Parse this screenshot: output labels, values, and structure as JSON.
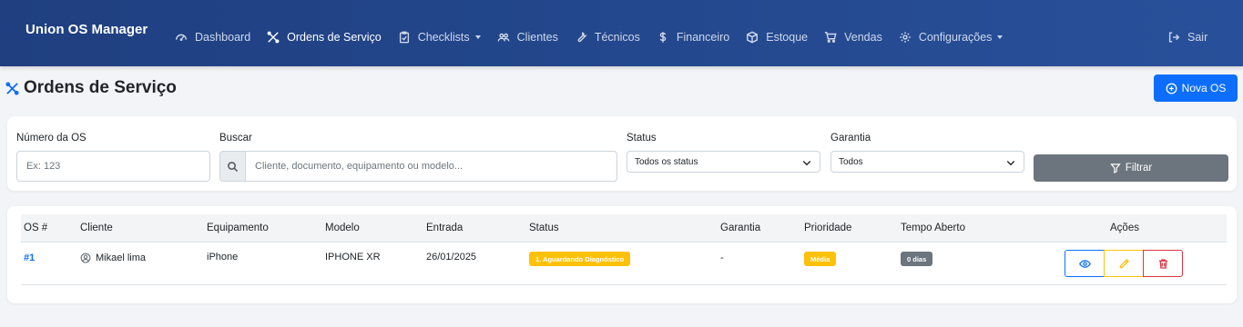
{
  "app": {
    "title": "Union OS Manager"
  },
  "nav": {
    "items": [
      {
        "label": "Dashboard",
        "icon": "gauge-icon"
      },
      {
        "label": "Ordens de Serviço",
        "icon": "tools-icon",
        "active": true
      },
      {
        "label": "Checklists",
        "icon": "clipboard-icon",
        "dropdown": true
      },
      {
        "label": "Clientes",
        "icon": "people-icon"
      },
      {
        "label": "Técnicos",
        "icon": "wrench-icon"
      },
      {
        "label": "Financeiro",
        "icon": "dollar-icon"
      },
      {
        "label": "Estoque",
        "icon": "box-icon"
      },
      {
        "label": "Vendas",
        "icon": "cart-icon"
      },
      {
        "label": "Configurações",
        "icon": "gear-icon",
        "dropdown": true
      }
    ],
    "logout_label": "Sair"
  },
  "header": {
    "title": "Ordens de Serviço",
    "new_button_label": "Nova OS"
  },
  "filters": {
    "numero_label": "Número da OS",
    "numero_placeholder": "Ex: 123",
    "buscar_label": "Buscar",
    "buscar_placeholder": "Cliente, documento, equipamento ou modelo...",
    "status_label": "Status",
    "status_value": "Todos os status",
    "garantia_label": "Garantia",
    "garantia_value": "Todos",
    "filter_button_label": "Filtrar"
  },
  "table": {
    "columns": [
      "OS #",
      "Cliente",
      "Equipamento",
      "Modelo",
      "Entrada",
      "Status",
      "Garantia",
      "Prioridade",
      "Tempo Aberto",
      "Ações"
    ],
    "rows": [
      {
        "os": "#1",
        "cliente": "Mikael lima",
        "equipamento": "iPhone",
        "modelo": "IPHONE XR",
        "entrada": "26/01/2025",
        "status": "1. Aguardando Diagnóstico",
        "garantia": "-",
        "prioridade": "Média",
        "tempo_aberto": "0 dias"
      }
    ]
  },
  "colors": {
    "navbar": "#1f3f80",
    "primary": "#0d6efd",
    "secondary": "#6c757d",
    "warning": "#ffc107",
    "danger": "#dc3545",
    "dark_badge": "#6c757d"
  }
}
